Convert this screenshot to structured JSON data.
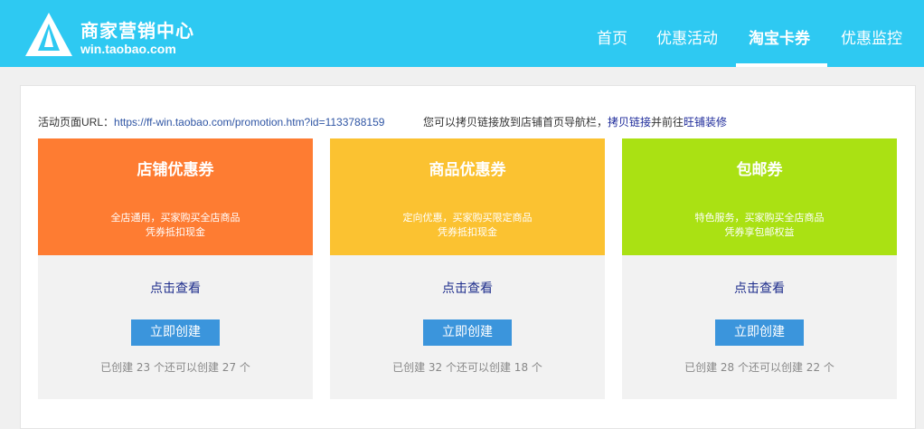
{
  "brand": {
    "title": "商家营销中心",
    "url": "win.taobao.com"
  },
  "nav": {
    "items": [
      {
        "label": "首页"
      },
      {
        "label": "优惠活动"
      },
      {
        "label": "淘宝卡券"
      },
      {
        "label": "优惠监控"
      }
    ],
    "active_index": 2
  },
  "activity": {
    "url_label": "活动页面URL：",
    "url_value": "https://ff-win.taobao.com/promotion.htm?id=1133788159",
    "tip_prefix": "您可以拷贝链接放到店铺首页导航栏，",
    "tip_copy_link": "拷贝链接",
    "tip_middle": "并前往",
    "tip_decorate_link": "旺铺装修"
  },
  "cards": [
    {
      "title": "店铺优惠券",
      "desc_line1": "全店通用，买家购买全店商品",
      "desc_line2": "凭券抵扣现金",
      "color": "#fe7c32",
      "view_label": "点击查看",
      "create_label": "立即创建",
      "created_text": "已创建 23 个还可以创建 27 个"
    },
    {
      "title": "商品优惠券",
      "desc_line1": "定向优惠，买家购买限定商品",
      "desc_line2": "凭券抵扣现金",
      "color": "#fbc231",
      "view_label": "点击查看",
      "create_label": "立即创建",
      "created_text": "已创建 32 个还可以创建 18 个"
    },
    {
      "title": "包邮券",
      "desc_line1": "特色服务，买家购买全店商品",
      "desc_line2": "凭券享包邮权益",
      "color": "#aae113",
      "view_label": "点击查看",
      "create_label": "立即创建",
      "created_text": "已创建 28 个还可以创建 22 个"
    }
  ],
  "colors": {
    "header_bg": "#2ec9f2",
    "button_bg": "#3b95dc",
    "link": "#1e2d8c"
  }
}
